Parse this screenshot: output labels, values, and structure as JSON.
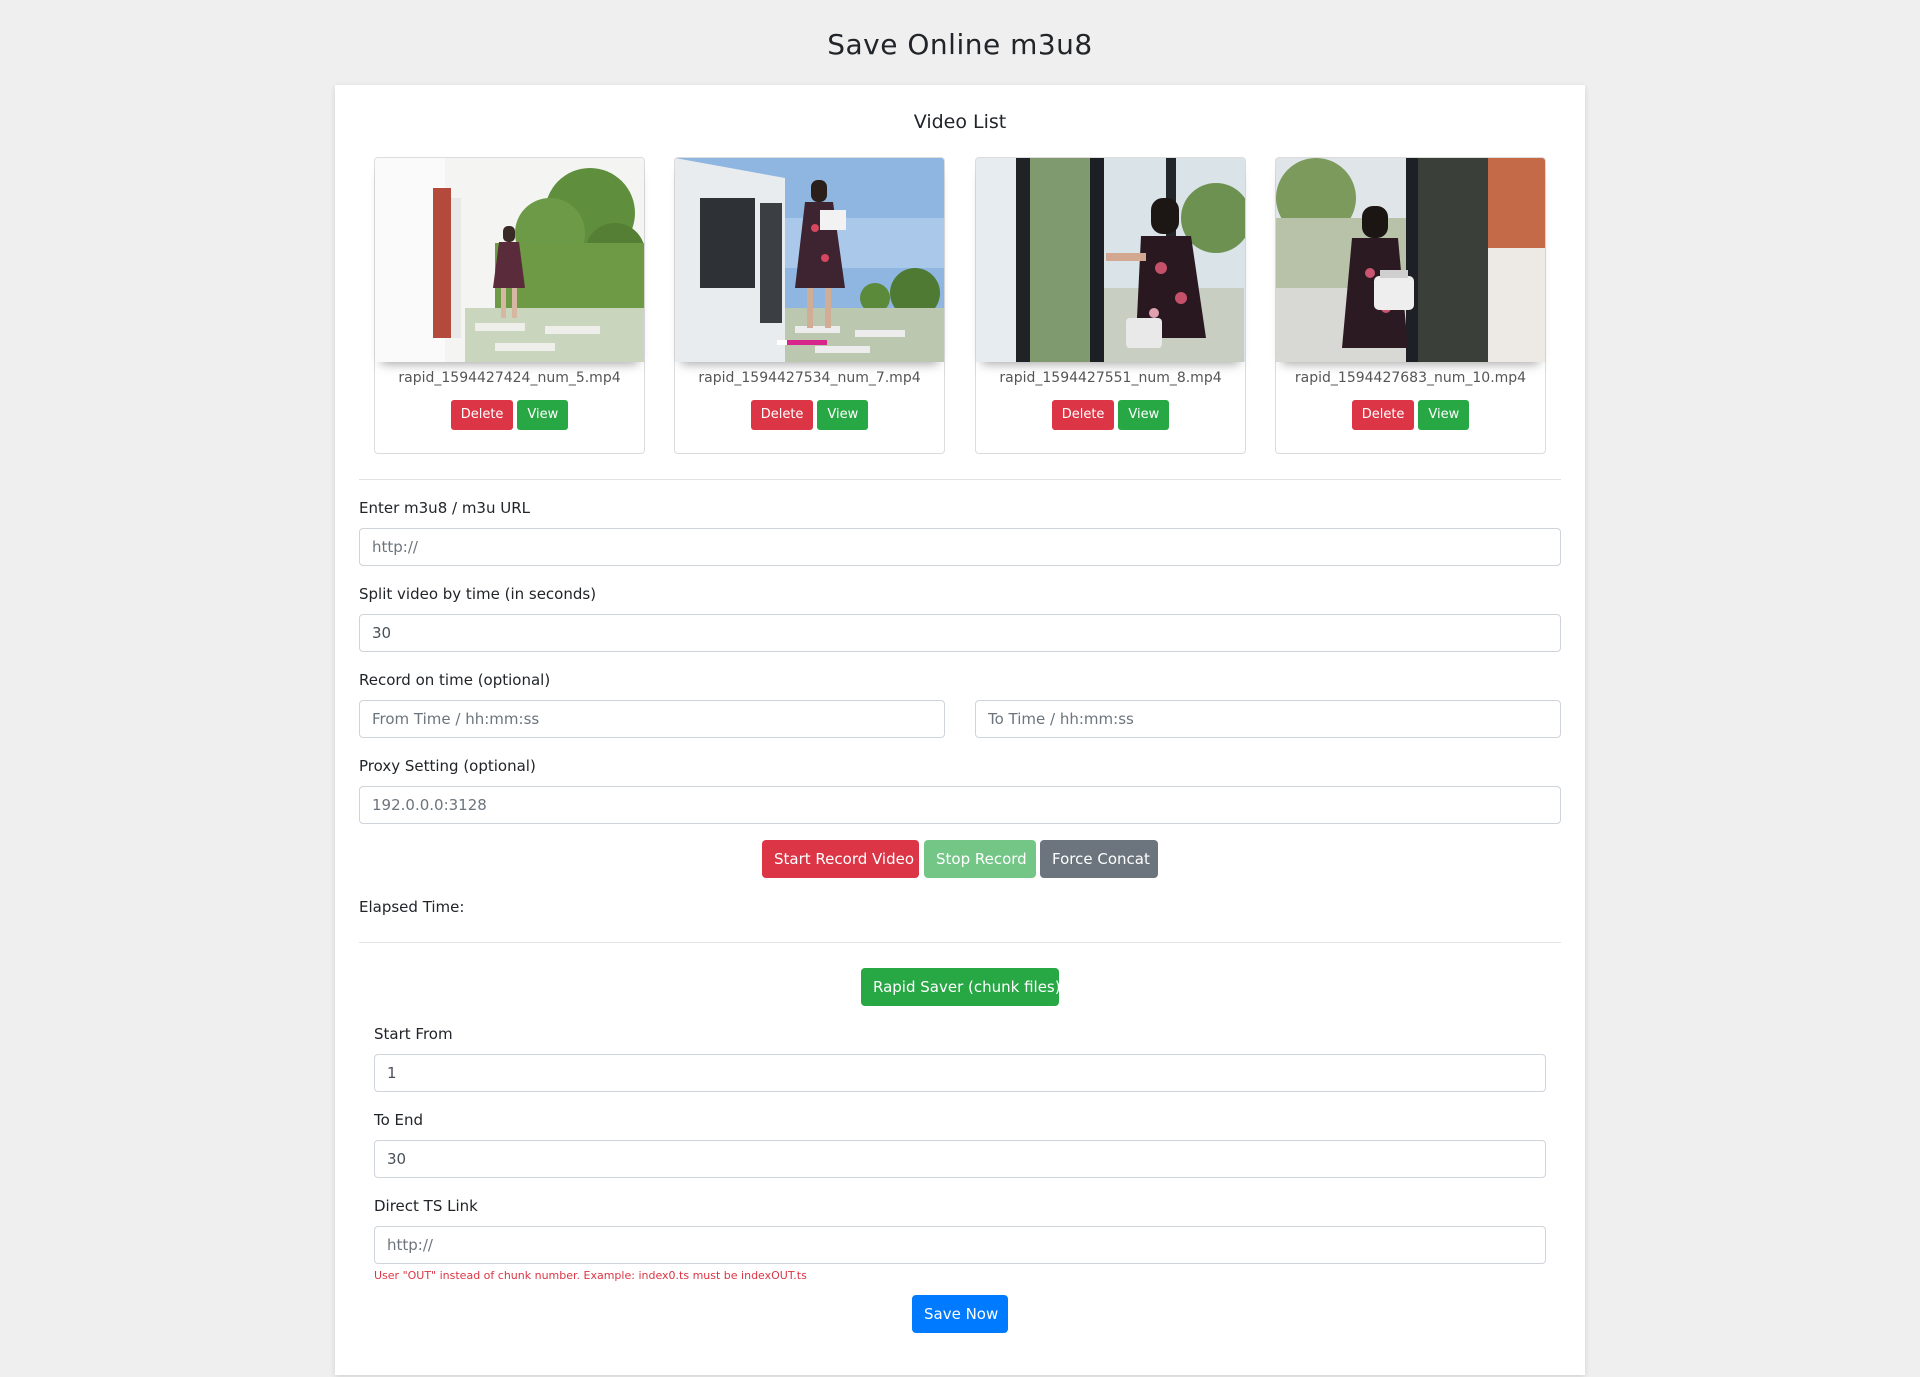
{
  "page": {
    "title": "Save Online m3u8"
  },
  "video_list": {
    "title": "Video List",
    "items": [
      {
        "name": "rapid_1594427424_num_5.mp4",
        "delete_label": "Delete",
        "view_label": "View"
      },
      {
        "name": "rapid_1594427534_num_7.mp4",
        "delete_label": "Delete",
        "view_label": "View"
      },
      {
        "name": "rapid_1594427551_num_8.mp4",
        "delete_label": "Delete",
        "view_label": "View"
      },
      {
        "name": "rapid_1594427683_num_10.mp4",
        "delete_label": "Delete",
        "view_label": "View"
      }
    ]
  },
  "record_form": {
    "url_label": "Enter m3u8 / m3u URL",
    "url_placeholder": "http://",
    "split_label": "Split video by time (in seconds)",
    "split_value": "30",
    "time_label": "Record on time (optional)",
    "from_placeholder": "From Time / hh:mm:ss",
    "to_placeholder": "To Time / hh:mm:ss",
    "proxy_label": "Proxy Setting (optional)",
    "proxy_placeholder": "192.0.0.0:3128",
    "start_label": "Start Record Video",
    "stop_label": "Stop Record",
    "concat_label": "Force Concat",
    "elapsed_label": "Elapsed Time:"
  },
  "rapid_saver": {
    "toggle_label": "Rapid Saver (chunk files)",
    "start_label": "Start From",
    "start_value": "1",
    "end_label": "To End",
    "end_value": "30",
    "ts_label": "Direct TS Link",
    "ts_placeholder": "http://",
    "hint": "User \"OUT\" instead of chunk number. Example: index0.ts must be indexOUT.ts",
    "save_label": "Save Now"
  },
  "colors": {
    "danger": "#dc3545",
    "success": "#28a745",
    "secondary": "#6c757d",
    "primary": "#007bff"
  }
}
